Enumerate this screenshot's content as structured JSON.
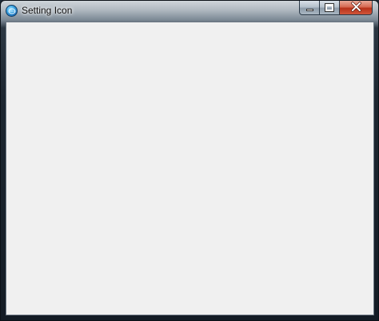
{
  "window": {
    "title": "Setting Icon",
    "app_icon": "app-globe-icon",
    "caption_buttons": {
      "minimize": "minimize-icon",
      "maximize": "maximize-icon",
      "close": "close-icon"
    }
  },
  "colors": {
    "client_background": "#f0f0f0",
    "close_button": "#c7432a"
  }
}
